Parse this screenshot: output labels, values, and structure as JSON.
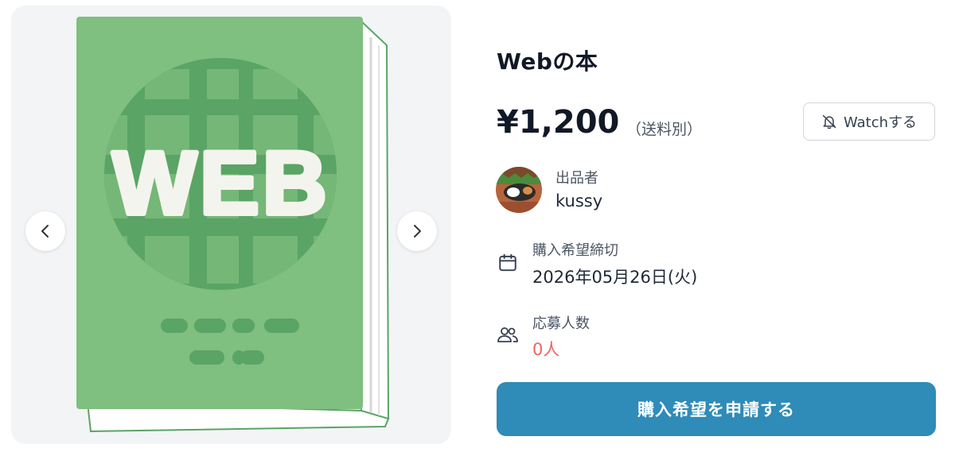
{
  "product": {
    "title": "Webの本",
    "price": "¥1,200",
    "shipping_note": "（送料別）",
    "image_text": "WEB"
  },
  "watch_button": {
    "label": "Watchする",
    "icon": "bell-off-icon"
  },
  "seller": {
    "label": "出品者",
    "name": "kussy"
  },
  "deadline": {
    "label": "購入希望締切",
    "value": "2026年05月26日(火)",
    "icon": "calendar-icon"
  },
  "applicants": {
    "label": "応募人数",
    "value": "0人",
    "icon": "users-icon"
  },
  "apply_button": {
    "label": "購入希望を申請する"
  },
  "gallery": {
    "prev_icon": "chevron-left-icon",
    "next_icon": "chevron-right-icon"
  },
  "colors": {
    "accent": "#2f8bb7",
    "applicant_count": "#ef6461",
    "book_cover": "#7fbf7f",
    "book_dark": "#5aa465"
  }
}
